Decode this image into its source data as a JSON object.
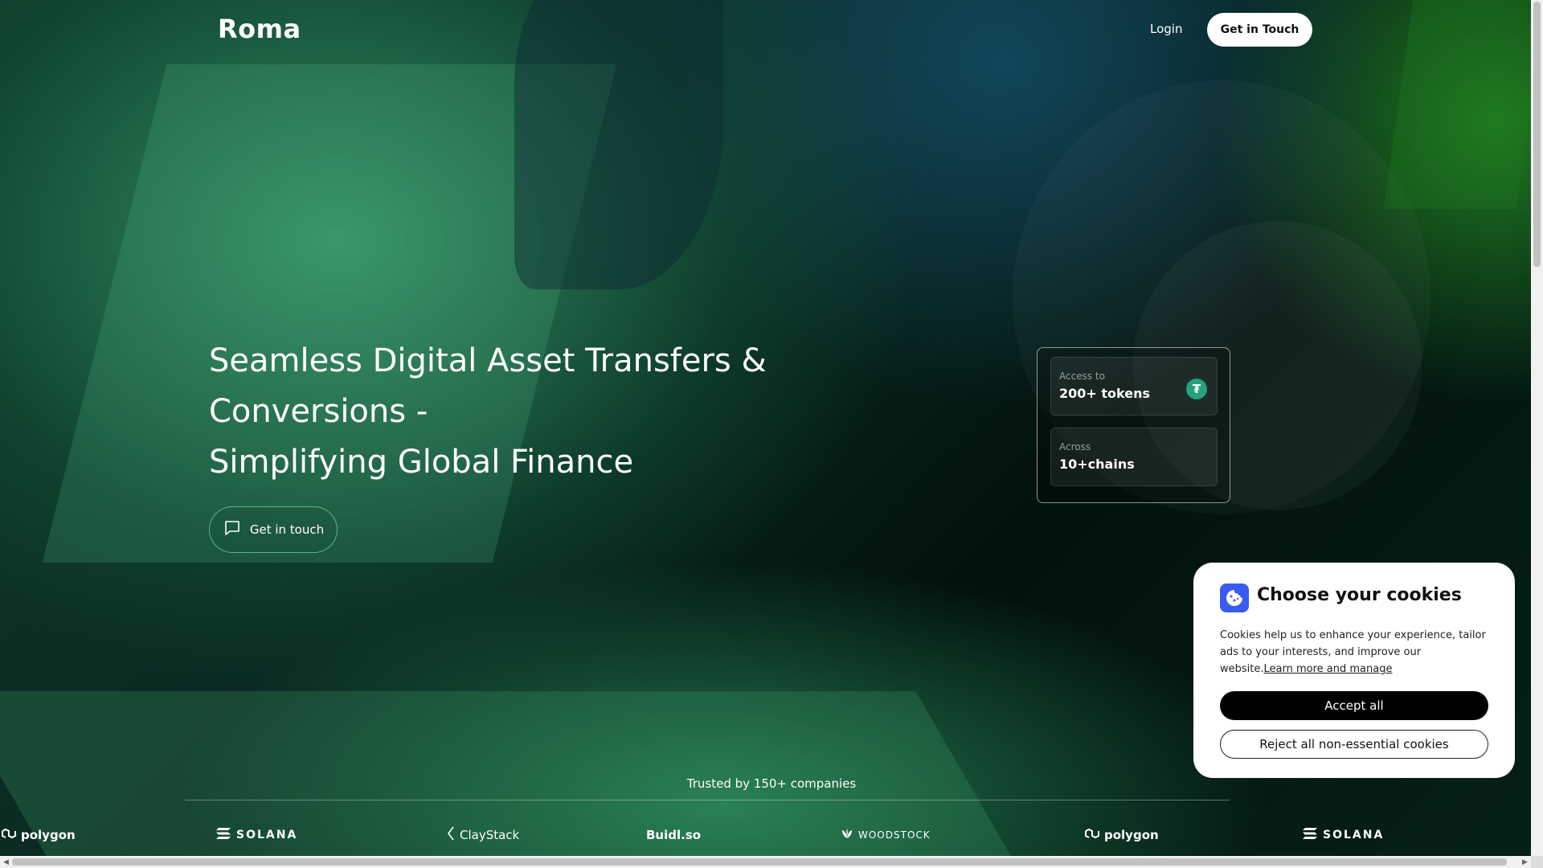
{
  "header": {
    "logo": "Roma",
    "login": "Login",
    "cta": "Get in Touch"
  },
  "hero": {
    "title_lines": [
      "Seamless Digital Asset Transfers &",
      "Conversions -",
      "Simplifying Global Finance"
    ],
    "button_label": "Get in touch"
  },
  "stats": [
    {
      "label": "Access to",
      "value": "200+ tokens",
      "icon": "tether-icon"
    },
    {
      "label": "Across",
      "value": "10+chains"
    }
  ],
  "trusted": {
    "label": "Trusted by 150+ companies",
    "logos": [
      {
        "name": "polygon",
        "icon": "polygon-icon"
      },
      {
        "name": "SOLANA",
        "icon": "solana-icon"
      },
      {
        "name": "ClayStack",
        "icon": "claystack-icon"
      },
      {
        "name": "Buidl.so"
      },
      {
        "name": "WOODSTOCK",
        "icon": "woodstock-icon"
      },
      {
        "name": "polygon",
        "icon": "polygon-icon"
      },
      {
        "name": "SOLANA",
        "icon": "solana-icon"
      }
    ]
  },
  "cookie": {
    "title": "Choose your cookies",
    "text": "Cookies help us to enhance your experience, tailor ads to your interests, and improve our website.",
    "link": "Learn more and manage",
    "accept": "Accept all",
    "reject": "Reject all non-essential cookies"
  },
  "colors": {
    "accent_green": "#26a17b",
    "cookie_icon_blue": "#3a5bf0"
  }
}
